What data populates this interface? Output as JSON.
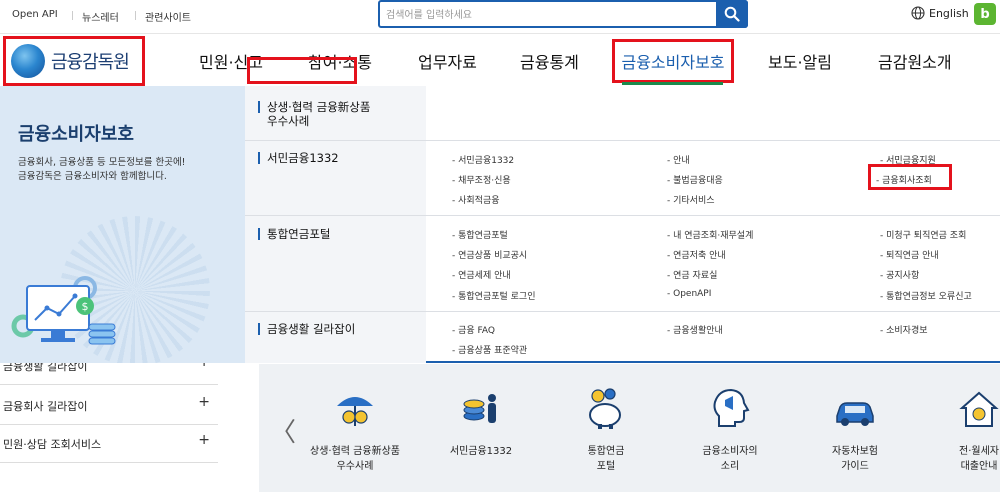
{
  "topbar": {
    "links": [
      "Open API",
      "뉴스레터",
      "관련사이트"
    ],
    "search_placeholder": "검색어를 입력하세요",
    "language": "English",
    "blog": "b"
  },
  "nav": {
    "logo_text": "금융감독원",
    "items": [
      "민원·신고",
      "참여·소통",
      "업무자료",
      "금융통계",
      "금융소비자보호",
      "보도·알림",
      "금감원소개"
    ],
    "active": "금융소비자보호"
  },
  "mega": {
    "title": "금융소비자보호",
    "desc": [
      "금융회사, 금융상품 등 모든정보를 한곳에!",
      "금융감독은 금융소비자와 함께합니다."
    ],
    "categories": [
      {
        "label": [
          "상생·협력 금융新상품",
          "우수사례"
        ],
        "links": []
      },
      {
        "label": [
          "서민금융1332"
        ],
        "links": [
          [
            "- 서민금융1332",
            "- 안내",
            "- 서민금융지원"
          ],
          [
            "- 채무조정·신용",
            "- 불법금융대응",
            "- 금융회사조회"
          ],
          [
            "- 사회적금융",
            "- 기타서비스",
            ""
          ]
        ]
      },
      {
        "label": [
          "통합연금포털"
        ],
        "links": [
          [
            "- 통합연금포털",
            "- 내 연금조회·재무설계",
            "- 미청구 퇴직연금 조회"
          ],
          [
            "- 연금상품 비교공시",
            "- 연금저축 안내",
            "- 퇴직연금 안내"
          ],
          [
            "- 연금세제 안내",
            "- 연금 자료실",
            "- 공지사항"
          ],
          [
            "- 통합연금포털 로그인",
            "- OpenAPI",
            "- 통합연금정보 오류신고"
          ]
        ]
      },
      {
        "label": [
          "금융생활 길라잡이"
        ],
        "links": [
          [
            "- 금융 FAQ",
            "- 금융생활안내",
            "- 소비자경보"
          ],
          [
            "- 금융상품 표준약관",
            "",
            ""
          ]
        ]
      }
    ]
  },
  "side": {
    "items": [
      "금융생활 길라잡이",
      "금융회사 길라잡이",
      "민원·상담 조회서비스"
    ],
    "plus": "+"
  },
  "quick": {
    "prev": "〈",
    "items": [
      {
        "icon": "umbrella-coins-icon",
        "label": [
          "상생·협력 금융新상품",
          "우수사례"
        ]
      },
      {
        "icon": "coins-person-icon",
        "label": [
          "서민금융1332"
        ]
      },
      {
        "icon": "piggy-bank-icon",
        "label": [
          "통합연금",
          "포털"
        ]
      },
      {
        "icon": "megaphone-head-icon",
        "label": [
          "금융소비자의",
          "소리"
        ]
      },
      {
        "icon": "car-icon",
        "label": [
          "자동차보험",
          "가이드"
        ]
      },
      {
        "icon": "house-icon",
        "label": [
          "전·월세자",
          "대출안내"
        ]
      }
    ]
  },
  "colors": {
    "primary": "#1b5fae",
    "highlight": "#e4121c",
    "panel": "#dbe8f5"
  }
}
